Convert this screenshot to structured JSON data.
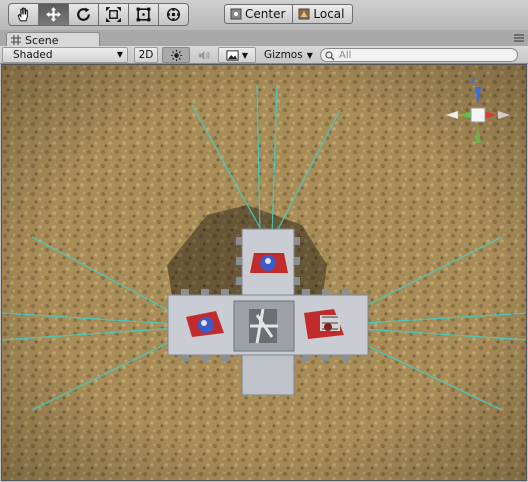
{
  "toolbar": {
    "tools": [
      {
        "name": "hand-tool",
        "icon": "hand-icon",
        "active": false
      },
      {
        "name": "move-tool",
        "icon": "move-arrows-icon",
        "active": true
      },
      {
        "name": "rotate-tool",
        "icon": "rotate-icon",
        "active": false
      },
      {
        "name": "scale-tool",
        "icon": "scale-icon",
        "active": false
      },
      {
        "name": "rect-tool",
        "icon": "rect-transform-icon",
        "active": false
      },
      {
        "name": "transform-tool",
        "icon": "transform-icon",
        "active": false
      }
    ],
    "pivot_label": "Center",
    "space_label": "Local"
  },
  "tab": {
    "label": "Scene",
    "icon": "grid-icon",
    "menu_icon": "tab-menu-icon"
  },
  "viewbar": {
    "shading_mode": "Shaded",
    "mode_2d_label": "2D",
    "lighting_icon": "sun-icon",
    "audio_icon": "speaker-icon",
    "effects_icon": "image-icon",
    "gizmos_label": "Gizmos",
    "search_placeholder": "All"
  },
  "scene": {
    "ground_color": "#a98d59",
    "spotlight_color": "#3fd0c8",
    "gizmo_axis_label": "z",
    "colors": {
      "axis_y": "#61c14a",
      "axis_x": "#e0392c",
      "axis_z": "#3f6be0",
      "building": "#c9ccd2",
      "robot_red": "#c22b2b",
      "robot_blue": "#3c5ac8"
    }
  }
}
